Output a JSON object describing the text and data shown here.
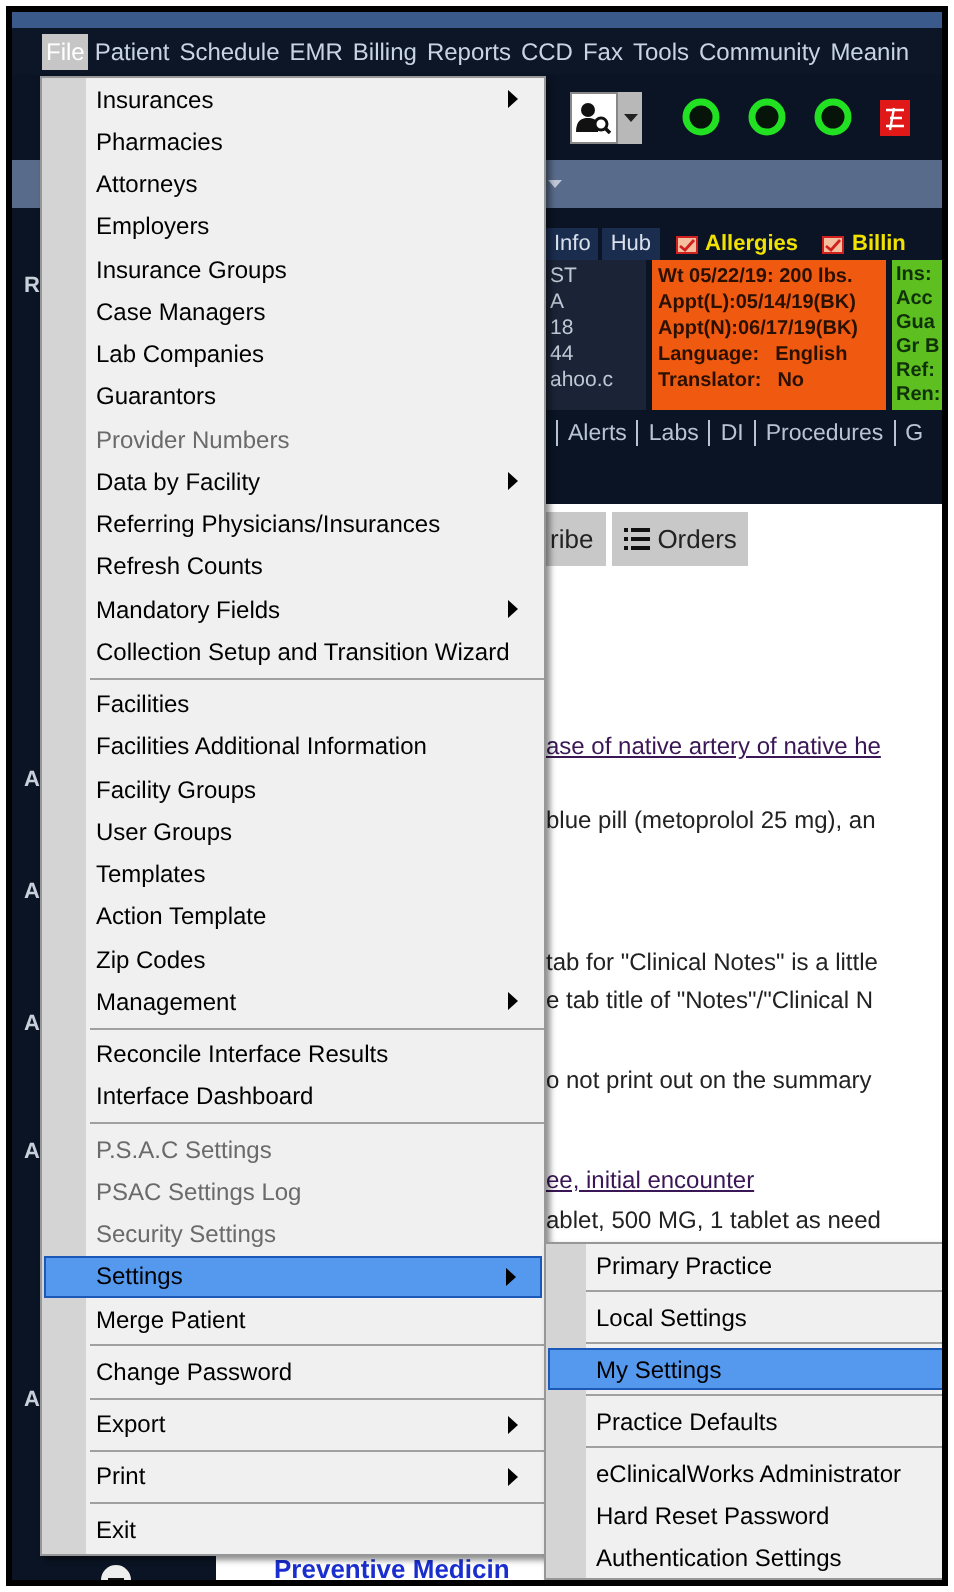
{
  "menu_bar": {
    "items": [
      {
        "label": "File",
        "selected": true
      },
      {
        "label": "Patient",
        "selected": false
      },
      {
        "label": "Schedule",
        "selected": false
      },
      {
        "label": "EMR",
        "selected": false
      },
      {
        "label": "Billing",
        "selected": false
      },
      {
        "label": "Reports",
        "selected": false
      },
      {
        "label": "CCD",
        "selected": false
      },
      {
        "label": "Fax",
        "selected": false
      },
      {
        "label": "Tools",
        "selected": false
      },
      {
        "label": "Community",
        "selected": false
      },
      {
        "label": "Meanin",
        "selected": false
      }
    ]
  },
  "patient_bar": {
    "tabs": [
      {
        "label": "Info",
        "kind": "tab"
      },
      {
        "label": "Hub",
        "kind": "tab"
      },
      {
        "label": "Allergies",
        "kind": "alert"
      },
      {
        "label": "Billin",
        "kind": "alert"
      }
    ],
    "demographics": [
      "ST",
      "A",
      "18",
      "44",
      "ahoo.c"
    ],
    "appointment_card": {
      "lines": [
        {
          "label": "Wt 05/22/19: 200 lbs."
        },
        {
          "label": "Appt(L):05/14/19(BK)"
        },
        {
          "label": "Appt(N):06/17/19(BK)"
        },
        {
          "label": "Language:",
          "value": "English"
        },
        {
          "label": "Translator:",
          "value": "No"
        }
      ]
    },
    "insurance_card": {
      "lines": [
        "Ins:",
        "Acc",
        "Gua",
        "Gr B",
        "Ref:",
        "Ren:"
      ]
    },
    "nav_links": [
      "Alerts",
      "Labs",
      "DI",
      "Procedures",
      "G"
    ]
  },
  "sidebar": {
    "labels": [
      "R",
      "A",
      "A",
      "A",
      "A",
      "A"
    ]
  },
  "tabs": [
    {
      "label": "ribe",
      "kind": "plain"
    },
    {
      "label": "Orders",
      "kind": "list"
    }
  ],
  "content": {
    "lines": [
      {
        "kind": "link",
        "text": "ase of native artery of native he"
      },
      {
        "kind": "text",
        "text": "blue pill (metoprolol 25 mg), an"
      },
      {
        "kind": "text",
        "text": "tab for \"Clinical Notes\" is a little"
      },
      {
        "kind": "text",
        "text": "e tab title of \"Notes\"/\"Clinical N"
      },
      {
        "kind": "text",
        "text": "o not print out on the summary"
      },
      {
        "kind": "link",
        "text": "ee, initial encounter"
      },
      {
        "kind": "text",
        "text": "ablet, 500 MG, 1 tablet as need"
      },
      {
        "kind": "heading",
        "text": "Preventive Medicin"
      }
    ]
  },
  "file_menu": {
    "groups": [
      {
        "items": [
          {
            "label": "Insurances",
            "submenu": true,
            "disabled": false,
            "selected": false
          },
          {
            "label": "Pharmacies",
            "submenu": false,
            "disabled": false,
            "selected": false
          },
          {
            "label": "Attorneys",
            "submenu": false,
            "disabled": false,
            "selected": false
          },
          {
            "label": "Employers",
            "submenu": false,
            "disabled": false,
            "selected": false
          },
          {
            "label": "Insurance Groups",
            "submenu": false,
            "disabled": false,
            "selected": false
          },
          {
            "label": "Case Managers",
            "submenu": false,
            "disabled": false,
            "selected": false
          },
          {
            "label": "Lab Companies",
            "submenu": false,
            "disabled": false,
            "selected": false
          },
          {
            "label": "Guarantors",
            "submenu": false,
            "disabled": false,
            "selected": false
          },
          {
            "label": "Provider Numbers",
            "submenu": false,
            "disabled": true,
            "selected": false
          },
          {
            "label": "Data by Facility",
            "submenu": true,
            "disabled": false,
            "selected": false
          },
          {
            "label": "Referring Physicians/Insurances",
            "submenu": false,
            "disabled": false,
            "selected": false
          },
          {
            "label": "Refresh Counts",
            "submenu": false,
            "disabled": false,
            "selected": false
          },
          {
            "label": "Mandatory Fields",
            "submenu": true,
            "disabled": false,
            "selected": false
          },
          {
            "label": "Collection Setup and Transition Wizard",
            "submenu": false,
            "disabled": false,
            "selected": false
          }
        ]
      },
      {
        "items": [
          {
            "label": "Facilities",
            "submenu": false,
            "disabled": false,
            "selected": false
          },
          {
            "label": "Facilities Additional Information",
            "submenu": false,
            "disabled": false,
            "selected": false
          },
          {
            "label": "Facility Groups",
            "submenu": false,
            "disabled": false,
            "selected": false
          },
          {
            "label": "User Groups",
            "submenu": false,
            "disabled": false,
            "selected": false
          },
          {
            "label": "Templates",
            "submenu": false,
            "disabled": false,
            "selected": false
          },
          {
            "label": "Action Template",
            "submenu": false,
            "disabled": false,
            "selected": false
          },
          {
            "label": "Zip Codes",
            "submenu": false,
            "disabled": false,
            "selected": false
          },
          {
            "label": "Management",
            "submenu": true,
            "disabled": false,
            "selected": false
          }
        ]
      },
      {
        "items": [
          {
            "label": "Reconcile Interface Results",
            "submenu": false,
            "disabled": false,
            "selected": false
          },
          {
            "label": "Interface Dashboard",
            "submenu": false,
            "disabled": false,
            "selected": false
          }
        ]
      },
      {
        "items": [
          {
            "label": "P.S.A.C Settings",
            "submenu": false,
            "disabled": true,
            "selected": false
          },
          {
            "label": "PSAC Settings Log",
            "submenu": false,
            "disabled": true,
            "selected": false
          },
          {
            "label": "Security Settings",
            "submenu": false,
            "disabled": true,
            "selected": false
          },
          {
            "label": "Settings",
            "submenu": true,
            "disabled": false,
            "selected": true
          },
          {
            "label": "Merge Patient",
            "submenu": false,
            "disabled": false,
            "selected": false
          }
        ]
      },
      {
        "items": [
          {
            "label": "Change Password",
            "submenu": false,
            "disabled": false,
            "selected": false
          }
        ]
      },
      {
        "items": [
          {
            "label": "Export",
            "submenu": true,
            "disabled": false,
            "selected": false
          }
        ]
      },
      {
        "items": [
          {
            "label": "Print",
            "submenu": true,
            "disabled": false,
            "selected": false
          }
        ]
      },
      {
        "items": [
          {
            "label": "Exit",
            "submenu": false,
            "disabled": false,
            "selected": false
          }
        ]
      }
    ]
  },
  "settings_submenu": {
    "groups": [
      {
        "items": [
          {
            "label": "Primary Practice",
            "submenu": false,
            "disabled": false,
            "selected": false
          }
        ]
      },
      {
        "items": [
          {
            "label": "Local Settings",
            "submenu": false,
            "disabled": false,
            "selected": false
          }
        ]
      },
      {
        "items": [
          {
            "label": "My Settings",
            "submenu": false,
            "disabled": false,
            "selected": true
          }
        ]
      },
      {
        "items": [
          {
            "label": "Practice Defaults",
            "submenu": false,
            "disabled": false,
            "selected": false
          }
        ]
      },
      {
        "items": [
          {
            "label": "eClinicalWorks Administrator",
            "submenu": false,
            "disabled": false,
            "selected": false
          },
          {
            "label": "Hard Reset Password",
            "submenu": false,
            "disabled": false,
            "selected": false
          },
          {
            "label": "Authentication Settings",
            "submenu": false,
            "disabled": false,
            "selected": false
          }
        ]
      }
    ]
  }
}
